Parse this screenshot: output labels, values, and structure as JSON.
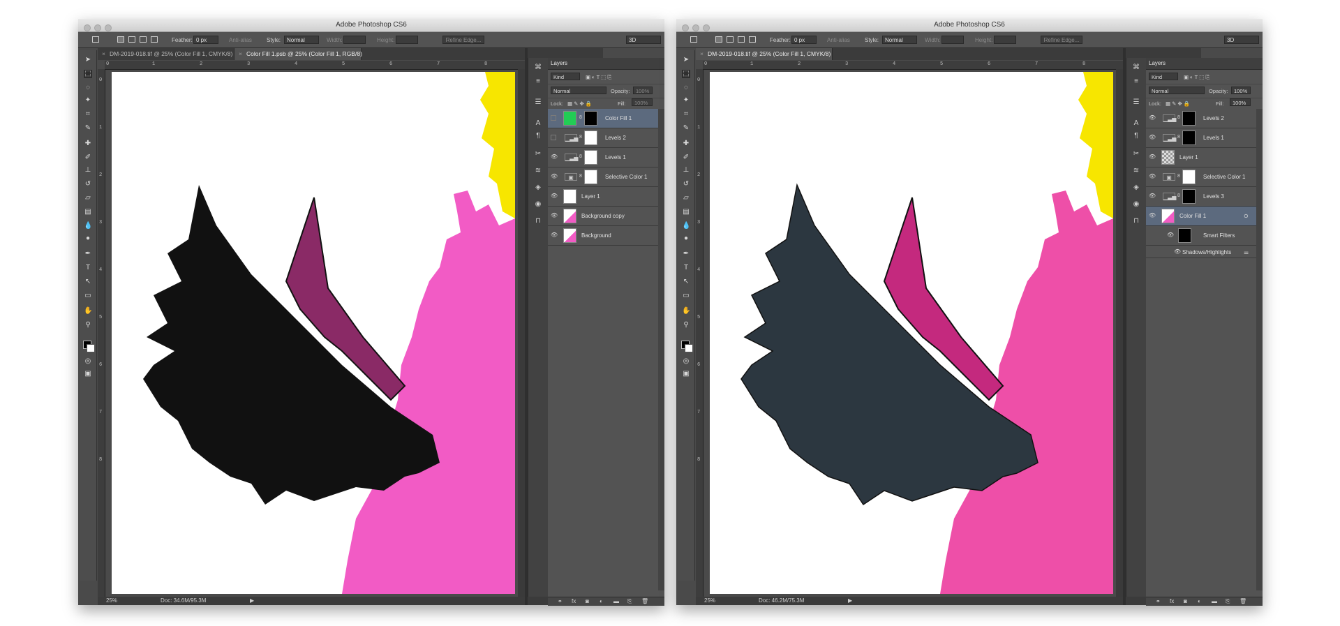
{
  "app_title": "Adobe Photoshop CS6",
  "windows": [
    {
      "options_bar": {
        "feather_label": "Feather:",
        "feather_value": "0 px",
        "antialias_label": "Anti-alias",
        "style_label": "Style:",
        "style_value": "Normal",
        "width_label": "Width:",
        "height_label": "Height:",
        "refine_label": "Refine Edge...",
        "workspace": "3D"
      },
      "tabs": [
        {
          "label": "DM-2019-018.tif @ 25% (Color Fill 1, CMYK/8)"
        },
        {
          "label": "Color Fill 1.psb @ 25% (Color Fill 1, RGB/8)"
        }
      ],
      "status": {
        "zoom": "25%",
        "doc": "Doc: 34.6M/95.3M"
      },
      "layers_panel": {
        "title": "Layers",
        "kind_label": "Kind",
        "blend_mode": "Normal",
        "opacity_label": "Opacity:",
        "opacity_value": "100%",
        "lock_label": "Lock:",
        "fill_label": "Fill:",
        "fill_value": "100%",
        "layers": [
          {
            "name": "Color Fill 1"
          },
          {
            "name": "Levels 2"
          },
          {
            "name": "Levels 1"
          },
          {
            "name": "Selective Color 1"
          },
          {
            "name": "Layer 1"
          },
          {
            "name": "Background copy"
          },
          {
            "name": "Background"
          }
        ]
      }
    },
    {
      "options_bar": {
        "feather_label": "Feather:",
        "feather_value": "0 px",
        "antialias_label": "Anti-alias",
        "style_label": "Style:",
        "style_value": "Normal",
        "width_label": "Width:",
        "height_label": "Height:",
        "refine_label": "Refine Edge...",
        "workspace": "3D"
      },
      "tabs": [
        {
          "label": "DM-2019-018.tif @ 25% (Color Fill 1, CMYK/8)"
        }
      ],
      "status": {
        "zoom": "25%",
        "doc": "Doc: 46.2M/75.3M"
      },
      "layers_panel": {
        "title": "Layers",
        "kind_label": "Kind",
        "blend_mode": "Normal",
        "opacity_label": "Opacity:",
        "opacity_value": "100%",
        "lock_label": "Lock:",
        "fill_label": "Fill:",
        "fill_value": "100%",
        "layers": [
          {
            "name": "Levels 2"
          },
          {
            "name": "Levels 1"
          },
          {
            "name": "Layer 1"
          },
          {
            "name": "Selective Color 1"
          },
          {
            "name": "Levels 3"
          },
          {
            "name": "Color Fill 1"
          },
          {
            "name": "Smart Filters"
          },
          {
            "name": "Shadows/Highlights"
          }
        ]
      }
    }
  ],
  "ruler_labels": [
    "0",
    "1",
    "2",
    "3",
    "4",
    "5",
    "6",
    "7",
    "8"
  ],
  "colors": {
    "fill_swatch": "#22cc55",
    "pink": "#f25bc5",
    "yellow": "#f7e600",
    "wing_left": "#111111",
    "wing_right": "#2c3740"
  }
}
